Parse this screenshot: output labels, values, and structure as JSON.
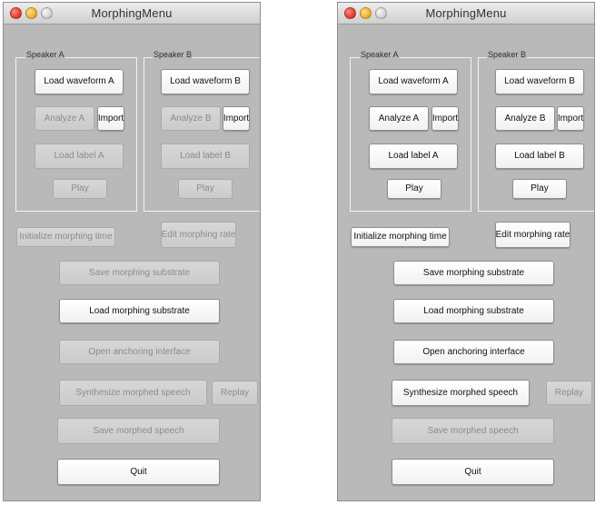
{
  "windows": [
    {
      "title": "MorphingMenu",
      "speaker_a_label": "Speaker A",
      "speaker_b_label": "Speaker B",
      "buttons": {
        "load_waveform_a": "Load waveform A",
        "analyze_a": "Analyze A",
        "import_a": "Import",
        "load_label_a": "Load label A",
        "play_a": "Play",
        "load_waveform_b": "Load waveform B",
        "analyze_b": "Analyze B",
        "import_b": "Import",
        "load_label_b": "Load label B",
        "play_b": "Play",
        "initialize_morphing_time": "Initialize morphing time",
        "edit_morphing_rate": "Edit morphing rate",
        "save_morphing_substrate": "Save morphing substrate",
        "load_morphing_substrate": "Load morphing substrate",
        "open_anchoring_interface": "Open anchoring interface",
        "synthesize_morphed_speech": "Synthesize morphed speech",
        "replay": "Replay",
        "save_morphed_speech": "Save morphed speech",
        "quit": "Quit"
      }
    },
    {
      "title": "MorphingMenu",
      "speaker_a_label": "Speaker A",
      "speaker_b_label": "Speaker B",
      "buttons": {
        "load_waveform_a": "Load waveform A",
        "analyze_a": "Analyze A",
        "import_a": "Import",
        "load_label_a": "Load label A",
        "play_a": "Play",
        "load_waveform_b": "Load waveform B",
        "analyze_b": "Analyze B",
        "import_b": "Import",
        "load_label_b": "Load label B",
        "play_b": "Play",
        "initialize_morphing_time": "Initialize morphing time",
        "edit_morphing_rate": "Edit morphing rate",
        "save_morphing_substrate": "Save morphing substrate",
        "load_morphing_substrate": "Load morphing substrate",
        "open_anchoring_interface": "Open anchoring interface",
        "synthesize_morphed_speech": "Synthesize morphed speech",
        "replay": "Replay",
        "save_morphed_speech": "Save morphed speech",
        "quit": "Quit"
      }
    }
  ]
}
